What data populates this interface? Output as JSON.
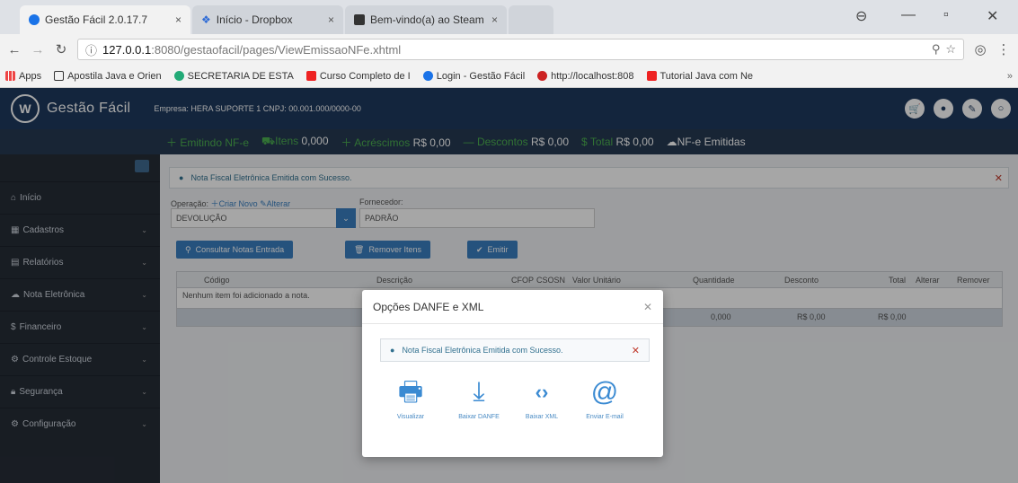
{
  "browser": {
    "tabs": [
      {
        "title": "Gestão Fácil 2.0.17.7",
        "close": "×"
      },
      {
        "title": "Início - Dropbox",
        "close": "×"
      },
      {
        "title": "Bem-vindo(a) ao Steam",
        "close": "×"
      }
    ],
    "url_host": "127.0.0.1",
    "url_path": ":8080/gestaofacil/pages/ViewEmissaoNFe.xhtml",
    "bookmarks": [
      "Apps",
      "Apostila Java e Orien",
      "SECRETARIA DE ESTA",
      "Curso Completo de I",
      "Login - Gestão Fácil",
      "http://localhost:808",
      "Tutorial Java com Ne"
    ]
  },
  "app": {
    "brand": "Gestão Fácil",
    "logo_glyph": "W",
    "empresa": "Empresa: HERA SUPORTE 1    CNPJ: 00.001.000/0000-00"
  },
  "status": {
    "emitindo": "Emitindo NF-e",
    "itens_label": "Itens",
    "itens_value": "0,000",
    "acrescimos_label": "Acréscimos",
    "acrescimos_value": "R$ 0,00",
    "descontos_label": "Descontos",
    "descontos_value": "R$ 0,00",
    "total_label": "Total",
    "total_value": "R$ 0,00",
    "emitidas": "NF-e Emitidas"
  },
  "sidebar": {
    "items": [
      {
        "label": "Início"
      },
      {
        "label": "Cadastros"
      },
      {
        "label": "Relatórios"
      },
      {
        "label": "Nota Eletrônica"
      },
      {
        "label": "Financeiro"
      },
      {
        "label": "Controle Estoque"
      },
      {
        "label": "Segurança"
      },
      {
        "label": "Configuração"
      }
    ]
  },
  "main": {
    "alert": "Nota Fiscal Eletrônica Emitida com Sucesso.",
    "operacao_label": "Operação:",
    "criar_novo": "Criar Novo",
    "alterar": "Alterar",
    "operacao_value": "DEVOLUÇÃO",
    "fornecedor_label": "Fornecedor:",
    "fornecedor_value": "PADRÃO",
    "btn_consultar": "Consultar Notas Entrada",
    "btn_remover": "Remover Itens",
    "btn_emitir": "Emitir",
    "columns": [
      "Código",
      "Descrição",
      "CFOP",
      "CSOSN",
      "Valor Unitário",
      "Quantidade",
      "Desconto",
      "Total",
      "Alterar",
      "Remover"
    ],
    "empty_msg": "Nenhum item foi adicionado a nota.",
    "footer_qtd": "0,000",
    "footer_desc": "R$ 0,00",
    "footer_total": "R$ 0,00"
  },
  "modal": {
    "title": "Opções DANFE e XML",
    "alert": "Nota Fiscal Eletrônica Emitida com Sucesso.",
    "actions": [
      {
        "label": "Visualizar",
        "icon": "printer-icon"
      },
      {
        "label": "Baixar DANFE",
        "icon": "download-icon"
      },
      {
        "label": "Baixar XML",
        "icon": "code-icon"
      },
      {
        "label": "Enviar E-mail",
        "icon": "at-icon"
      }
    ]
  }
}
